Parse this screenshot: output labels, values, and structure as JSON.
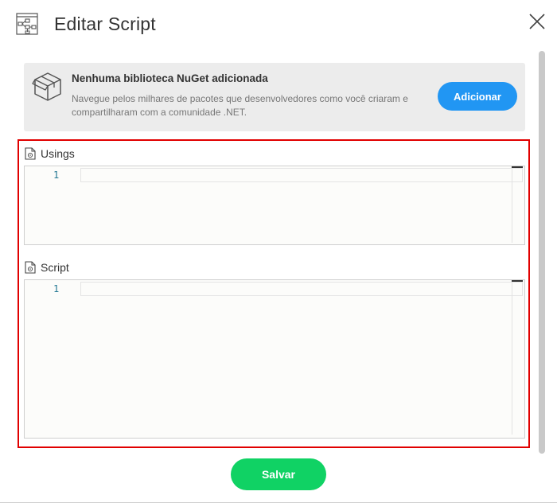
{
  "dialog": {
    "title": "Editar Script",
    "header_icon": "flowchart-icon",
    "close_icon": "close-icon"
  },
  "nuget": {
    "icon": "box-icon",
    "title": "Nenhuma biblioteca NuGet adicionada",
    "description": "Navegue pelos milhares de pacotes que desenvolvedores como você criaram e compartilharam com a comunidade .NET.",
    "add_label": "Adicionar"
  },
  "usings": {
    "label": "Usings",
    "icon": "code-file-icon",
    "line_number": "1",
    "value": ""
  },
  "script": {
    "label": "Script",
    "icon": "code-file-icon",
    "line_number": "1",
    "value": ""
  },
  "footer": {
    "save_label": "Salvar"
  },
  "colors": {
    "primary": "#2196f3",
    "success": "#10d264",
    "highlight": "#e10000",
    "panel": "#ececec"
  }
}
